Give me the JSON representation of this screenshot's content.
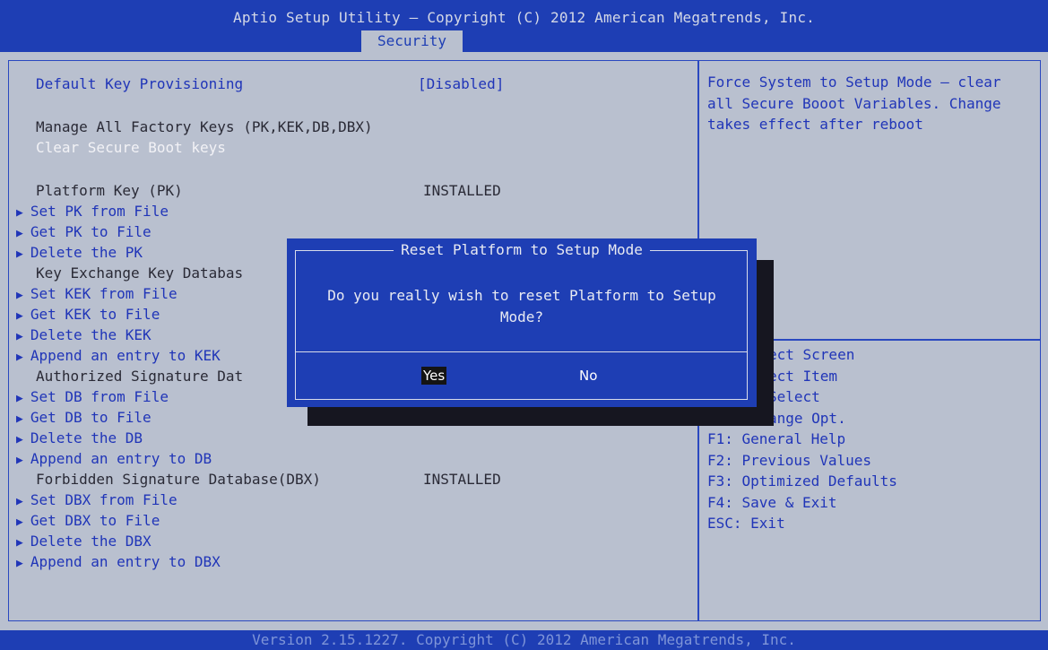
{
  "header": {
    "title": "Aptio Setup Utility – Copyright (C) 2012 American Megatrends, Inc.",
    "active_tab": "Security"
  },
  "menu": {
    "default_key_provisioning": {
      "label": "Default Key Provisioning",
      "value": "[Disabled]"
    },
    "manage_factory_keys": "Manage All Factory Keys (PK,KEK,DB,DBX)",
    "clear_secure_boot_keys": "Clear Secure Boot keys",
    "platform_key": {
      "label": "Platform Key (PK)",
      "value": "INSTALLED"
    },
    "set_pk": "Set PK from File",
    "get_pk": "Get PK to File",
    "delete_pk": "Delete the PK",
    "kek_db": "Key Exchange Key Databas",
    "set_kek": "Set KEK from File",
    "get_kek": "Get KEK to File",
    "delete_kek": "Delete the KEK",
    "append_kek": "Append an entry to KEK",
    "auth_sig_db": "Authorized Signature Dat",
    "set_db": "Set DB from File",
    "get_db": "Get DB to File",
    "delete_db": "Delete the DB",
    "append_db": "Append an entry to DB",
    "forbidden_db": {
      "label": "Forbidden Signature Database(DBX)",
      "value": "INSTALLED"
    },
    "set_dbx": "Set DBX from File",
    "get_dbx": "Get DBX to File",
    "delete_dbx": "Delete the DBX",
    "append_dbx": "Append an entry to DBX"
  },
  "help": {
    "text": "Force System to Setup Mode – clear all Secure Booot Variables. Change takes effect after reboot",
    "keys": [
      "ect Screen",
      "ect Item",
      "Select",
      "ange Opt.",
      "F1: General Help",
      "F2: Previous Values",
      "F3: Optimized Defaults",
      "F4: Save & Exit",
      "ESC: Exit"
    ]
  },
  "dialog": {
    "title": "Reset Platform to Setup Mode",
    "message": "Do you really wish to reset Platform to Setup Mode?",
    "yes_label": "Yes",
    "no_label": "No"
  },
  "footer": {
    "text": "Version 2.15.1227. Copyright (C) 2012 American Megatrends, Inc."
  },
  "colors": {
    "header_blue": "#1e3eb4",
    "background": "#b9c0cf",
    "menu_text": "#2035b8",
    "highlight": "#f2f2f6"
  }
}
